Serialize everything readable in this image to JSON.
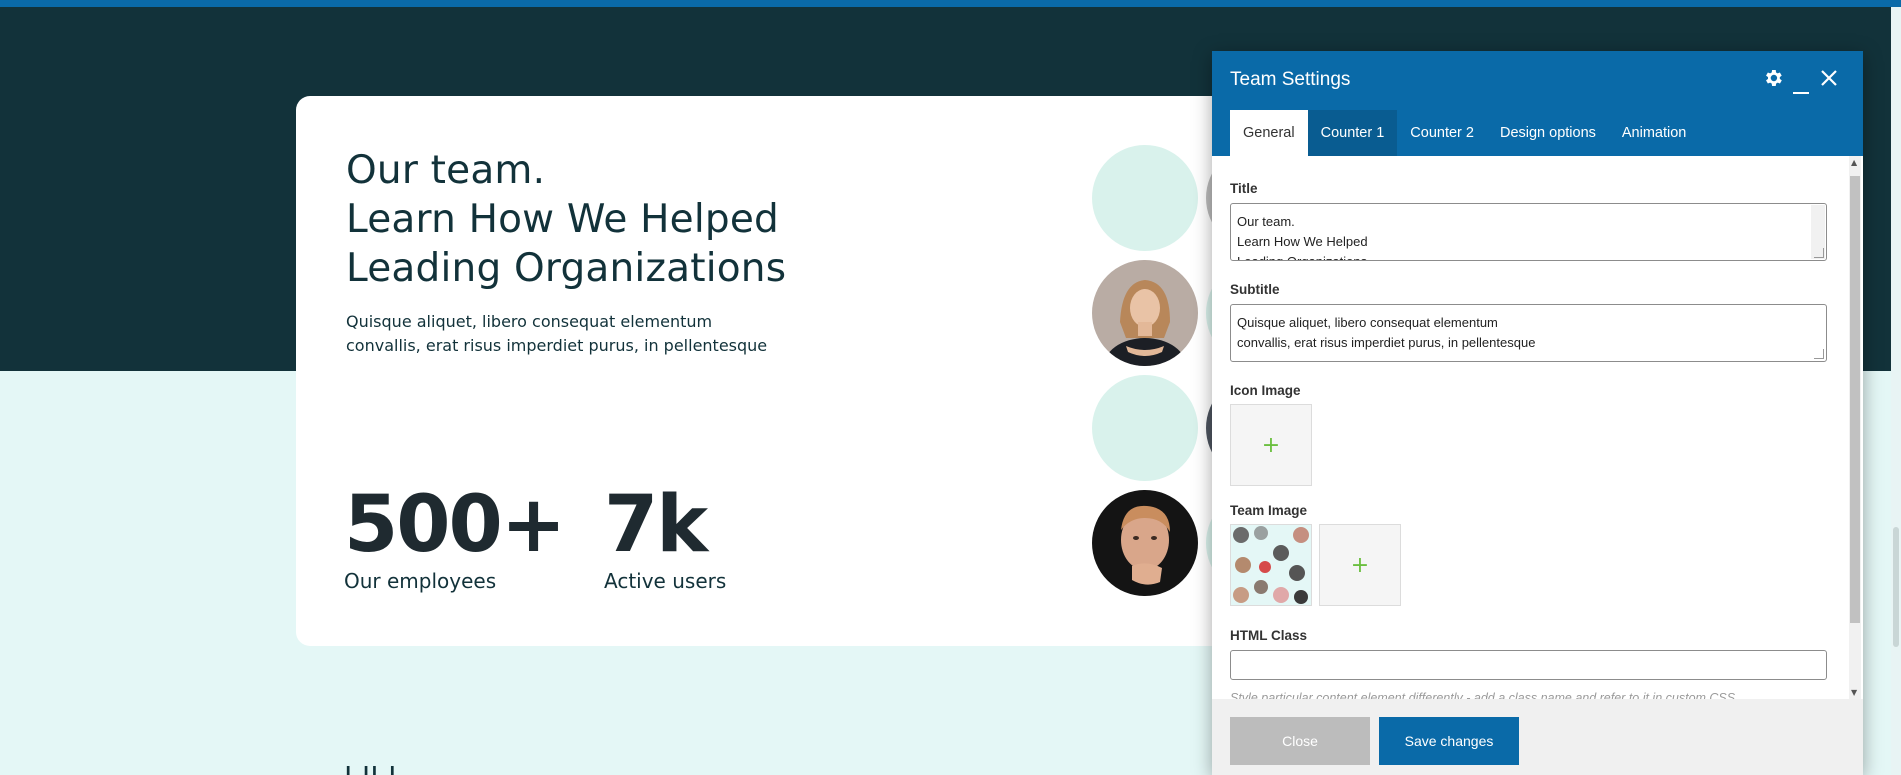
{
  "page": {
    "hero": {
      "title_lines": [
        "Our team.",
        "Learn How We Helped",
        "Leading Organizations"
      ],
      "subtitle_lines": [
        "Quisque aliquet, libero consequat elementum",
        "convallis, erat risus imperdiet purus, in pellentesque"
      ]
    },
    "stats": [
      {
        "value": "500+",
        "label": "Our employees"
      },
      {
        "value": "7k",
        "label": "Active users"
      }
    ],
    "colors": {
      "dark_band": "#12323a",
      "light_band": "#e4f7f6",
      "accent": "#0a6aa8",
      "mint": "#d9f2ec"
    }
  },
  "modal": {
    "title": "Team Settings",
    "header_icons": [
      "gear-icon",
      "minimize-icon",
      "close-icon"
    ],
    "tabs": [
      {
        "label": "General",
        "active": true
      },
      {
        "label": "Counter 1",
        "active": false
      },
      {
        "label": "Counter 2",
        "active": false
      },
      {
        "label": "Design options",
        "active": false
      },
      {
        "label": "Animation",
        "active": false
      }
    ],
    "fields": {
      "title_label": "Title",
      "title_value_lines": [
        "Our team.",
        "Learn How We Helped",
        "Leading Organizations"
      ],
      "subtitle_label": "Subtitle",
      "subtitle_value_lines": [
        "Quisque aliquet, libero consequat elementum",
        "convallis, erat risus imperdiet purus, in pellentesque"
      ],
      "icon_image_label": "Icon Image",
      "team_image_label": "Team Image",
      "add_symbol": "+",
      "html_class_label": "HTML Class",
      "html_class_value": "",
      "html_class_help": "Style particular content element differently - add a class name and refer to it in custom CSS."
    },
    "footer": {
      "close_label": "Close",
      "save_label": "Save changes"
    }
  }
}
